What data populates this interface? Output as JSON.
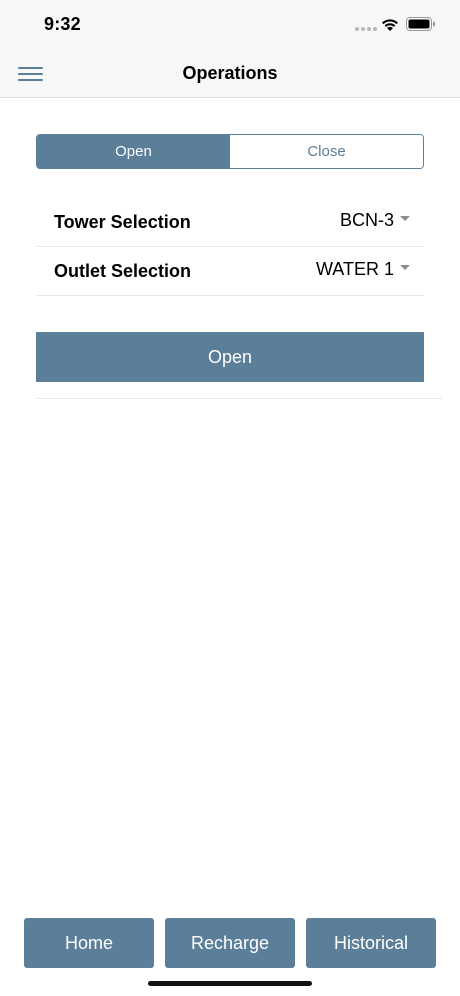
{
  "status_bar": {
    "time": "9:32"
  },
  "nav": {
    "title": "Operations"
  },
  "segments": [
    {
      "label": "Open",
      "active": true
    },
    {
      "label": "Close",
      "active": false
    }
  ],
  "form": {
    "tower": {
      "label": "Tower Selection",
      "value": "BCN-3"
    },
    "outlet": {
      "label": "Outlet Selection",
      "value": "WATER 1"
    }
  },
  "action_button": {
    "label": "Open"
  },
  "tabs": [
    {
      "label": "Home"
    },
    {
      "label": "Recharge"
    },
    {
      "label": "Historical"
    }
  ],
  "colors": {
    "accent": "#5b7e99",
    "nav_bg": "#f7f7f7"
  }
}
